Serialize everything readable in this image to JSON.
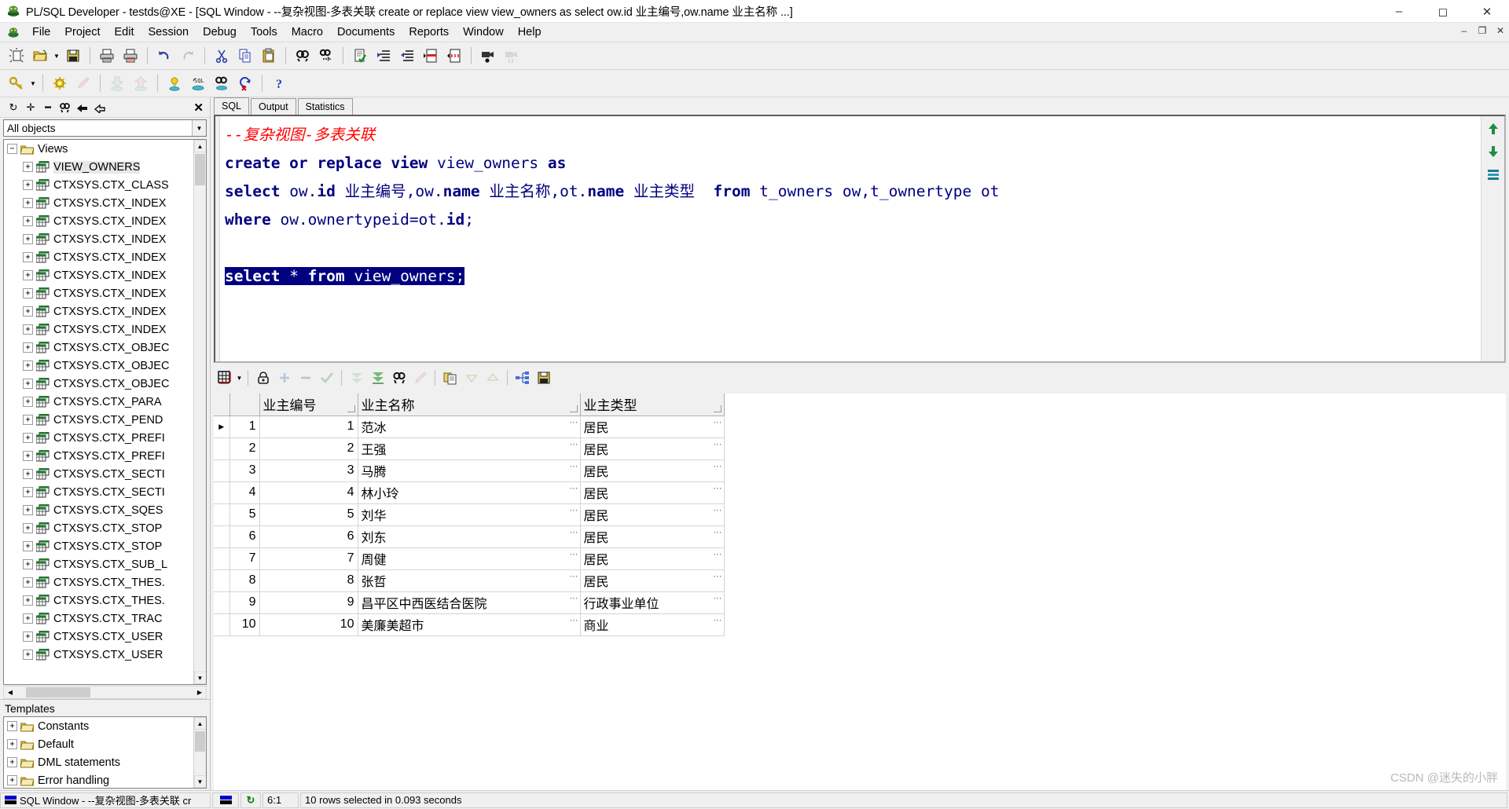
{
  "window": {
    "title": "PL/SQL Developer - testds@XE - [SQL Window - --复杂视图-多表关联 create or replace view view_owners as select ow.id 业主编号,ow.name 业主名称 ...]",
    "app_icon": "plsql-developer-icon",
    "minimize": "–",
    "maximize": "◻",
    "close": "✕",
    "mdi_minimize": "–",
    "mdi_restore": "❐",
    "mdi_close": "✕"
  },
  "menu": {
    "icon": "plsql-developer-icon",
    "items": [
      {
        "label": "File"
      },
      {
        "label": "Project"
      },
      {
        "label": "Edit"
      },
      {
        "label": "Session"
      },
      {
        "label": "Debug"
      },
      {
        "label": "Tools"
      },
      {
        "label": "Macro"
      },
      {
        "label": "Documents"
      },
      {
        "label": "Reports"
      },
      {
        "label": "Window"
      },
      {
        "label": "Help"
      }
    ]
  },
  "toolbar_main": [
    {
      "name": "new-icon",
      "glyph": "▯",
      "disabled": false
    },
    {
      "name": "open-icon",
      "glyph": "📂",
      "disabled": false
    },
    {
      "name": "open-dropdown-arrow-icon",
      "glyph": "▼",
      "dropdown": true
    },
    {
      "name": "save-icon",
      "glyph": "💾",
      "disabled": false
    },
    {
      "name": "separator",
      "sep": true
    },
    {
      "name": "print-icon",
      "glyph": "🖶",
      "disabled": false
    },
    {
      "name": "print-preview-icon",
      "glyph": "🖶",
      "disabled": false
    },
    {
      "name": "separator",
      "sep": true
    },
    {
      "name": "undo-icon",
      "glyph": "↶",
      "disabled": false
    },
    {
      "name": "redo-icon",
      "glyph": "↷",
      "disabled": true
    },
    {
      "name": "separator",
      "sep": true
    },
    {
      "name": "cut-icon",
      "glyph": "✂",
      "disabled": false
    },
    {
      "name": "copy-icon",
      "glyph": "⧉",
      "disabled": false
    },
    {
      "name": "paste-icon",
      "glyph": "📋",
      "disabled": false
    },
    {
      "name": "separator",
      "sep": true
    },
    {
      "name": "find-icon",
      "glyph": "🔍",
      "disabled": false
    },
    {
      "name": "find-next-icon",
      "glyph": "🔍",
      "disabled": false
    },
    {
      "name": "separator",
      "sep": true
    },
    {
      "name": "check-syntax-icon",
      "glyph": "📄",
      "disabled": false
    },
    {
      "name": "indent-icon",
      "glyph": "⇥",
      "disabled": false
    },
    {
      "name": "outdent-icon",
      "glyph": "⇤",
      "disabled": false
    },
    {
      "name": "comment-icon",
      "glyph": "▤",
      "disabled": false
    },
    {
      "name": "uncomment-icon",
      "glyph": "▤",
      "disabled": false
    },
    {
      "name": "separator",
      "sep": true
    },
    {
      "name": "record-macro-icon",
      "glyph": "🎥",
      "disabled": false
    },
    {
      "name": "play-macro-icon",
      "glyph": "🎥",
      "disabled": true
    }
  ],
  "toolbar_secondary": [
    {
      "name": "explain-plan-icon",
      "glyph": "🔑",
      "disabled": false
    },
    {
      "name": "explain-plan-dropdown-arrow-icon",
      "glyph": "▼",
      "dropdown": true
    },
    {
      "name": "separator",
      "sep": true
    },
    {
      "name": "beautifier-icon",
      "glyph": "⚙",
      "disabled": false
    },
    {
      "name": "pencil-icon",
      "glyph": "✎",
      "disabled": true
    },
    {
      "name": "separator",
      "sep": true
    },
    {
      "name": "import-table-icon",
      "glyph": "⬇",
      "disabled": true
    },
    {
      "name": "export-table-icon",
      "glyph": "⬆",
      "disabled": true
    },
    {
      "name": "separator",
      "sep": true
    },
    {
      "name": "session-info-icon",
      "glyph": "💡",
      "disabled": false
    },
    {
      "name": "sql-window-icon",
      "glyph": "SQL",
      "disabled": false
    },
    {
      "name": "find-database-objects-icon",
      "glyph": "🔍",
      "disabled": false
    },
    {
      "name": "rollback-icon",
      "glyph": "↺",
      "disabled": false
    },
    {
      "name": "separator",
      "sep": true
    },
    {
      "name": "help-icon",
      "glyph": "?",
      "disabled": false
    }
  ],
  "browser": {
    "toolbar": [
      {
        "name": "refresh-icon",
        "glyph": "↻"
      },
      {
        "name": "expand-all-icon",
        "glyph": "✛"
      },
      {
        "name": "collapse-all-icon",
        "glyph": "━"
      },
      {
        "name": "find-object-icon",
        "glyph": "🔍"
      },
      {
        "name": "goto-icon",
        "glyph": "↯"
      },
      {
        "name": "filter-icon",
        "glyph": "⌁"
      }
    ],
    "close_glyph": "✕",
    "filter_value": "All objects",
    "filter_arrow": "▼",
    "root": {
      "label": "Views",
      "expander": "−",
      "icon": "folder-open-icon"
    },
    "items": [
      {
        "label": "VIEW_OWNERS",
        "selected": true
      },
      {
        "label": "CTXSYS.CTX_CLASS",
        "selected": false
      },
      {
        "label": "CTXSYS.CTX_INDEX",
        "selected": false
      },
      {
        "label": "CTXSYS.CTX_INDEX",
        "selected": false
      },
      {
        "label": "CTXSYS.CTX_INDEX",
        "selected": false
      },
      {
        "label": "CTXSYS.CTX_INDEX",
        "selected": false
      },
      {
        "label": "CTXSYS.CTX_INDEX",
        "selected": false
      },
      {
        "label": "CTXSYS.CTX_INDEX",
        "selected": false
      },
      {
        "label": "CTXSYS.CTX_INDEX",
        "selected": false
      },
      {
        "label": "CTXSYS.CTX_INDEX",
        "selected": false
      },
      {
        "label": "CTXSYS.CTX_OBJEC",
        "selected": false
      },
      {
        "label": "CTXSYS.CTX_OBJEC",
        "selected": false
      },
      {
        "label": "CTXSYS.CTX_OBJEC",
        "selected": false
      },
      {
        "label": "CTXSYS.CTX_PARA",
        "selected": false
      },
      {
        "label": "CTXSYS.CTX_PEND",
        "selected": false
      },
      {
        "label": "CTXSYS.CTX_PREFI",
        "selected": false
      },
      {
        "label": "CTXSYS.CTX_PREFI",
        "selected": false
      },
      {
        "label": "CTXSYS.CTX_SECTI",
        "selected": false
      },
      {
        "label": "CTXSYS.CTX_SECTI",
        "selected": false
      },
      {
        "label": "CTXSYS.CTX_SQES",
        "selected": false
      },
      {
        "label": "CTXSYS.CTX_STOP",
        "selected": false
      },
      {
        "label": "CTXSYS.CTX_STOP",
        "selected": false
      },
      {
        "label": "CTXSYS.CTX_SUB_L",
        "selected": false
      },
      {
        "label": "CTXSYS.CTX_THES.",
        "selected": false
      },
      {
        "label": "CTXSYS.CTX_THES.",
        "selected": false
      },
      {
        "label": "CTXSYS.CTX_TRAC",
        "selected": false
      },
      {
        "label": "CTXSYS.CTX_USER",
        "selected": false
      },
      {
        "label": "CTXSYS.CTX_USER",
        "selected": false
      }
    ]
  },
  "templates": {
    "header": "Templates",
    "items": [
      {
        "label": "Constants",
        "expander": "+"
      },
      {
        "label": "Default",
        "expander": "+"
      },
      {
        "label": "DML statements",
        "expander": "+"
      },
      {
        "label": "Error handling",
        "expander": "+"
      }
    ]
  },
  "tabs": [
    {
      "label": "SQL",
      "active": true
    },
    {
      "label": "Output",
      "active": false
    },
    {
      "label": "Statistics",
      "active": false
    }
  ],
  "editor": {
    "lines": [
      {
        "kind": "comment",
        "text": "--复杂视图-多表关联"
      },
      {
        "kind": "code",
        "segments": [
          {
            "t": "create or replace view ",
            "c": "kw"
          },
          {
            "t": "view_owners ",
            "c": "id"
          },
          {
            "t": "as",
            "c": "kw"
          }
        ]
      },
      {
        "kind": "code",
        "segments": [
          {
            "t": "select ",
            "c": "kw"
          },
          {
            "t": "ow.",
            "c": "id"
          },
          {
            "t": "id",
            "c": "kw"
          },
          {
            "t": " 业主编号,",
            "c": "id"
          },
          {
            "t": "ow.",
            "c": "id"
          },
          {
            "t": "name",
            "c": "kw"
          },
          {
            "t": " 业主名称,",
            "c": "id"
          },
          {
            "t": "ot.",
            "c": "id"
          },
          {
            "t": "name",
            "c": "kw"
          },
          {
            "t": " 业主类型  ",
            "c": "id"
          },
          {
            "t": "from ",
            "c": "kw"
          },
          {
            "t": "t_owners ow,t_ownertype ot",
            "c": "id"
          }
        ]
      },
      {
        "kind": "code",
        "segments": [
          {
            "t": "where ",
            "c": "kw"
          },
          {
            "t": "ow.ownertypeid=ot.",
            "c": "id"
          },
          {
            "t": "id",
            "c": "kw"
          },
          {
            "t": ";",
            "c": "id"
          }
        ]
      },
      {
        "kind": "blank",
        "text": ""
      },
      {
        "kind": "selected",
        "segments": [
          {
            "t": "select ",
            "c": "kw"
          },
          {
            "t": "* ",
            "c": "id"
          },
          {
            "t": "from ",
            "c": "kw"
          },
          {
            "t": "view_owners;",
            "c": "id"
          }
        ]
      }
    ],
    "side_buttons": [
      {
        "name": "scroll-up-icon",
        "glyph": "⬆",
        "color": "#2e8b2e"
      },
      {
        "name": "scroll-down-icon",
        "glyph": "⬇",
        "color": "#2e8b2e"
      },
      {
        "name": "statement-list-icon",
        "glyph": "▤",
        "color": "#1a7a9a"
      }
    ]
  },
  "grid_toolbar": [
    {
      "name": "grid-layout-icon",
      "glyph": "▦",
      "disabled": false
    },
    {
      "name": "grid-layout-dropdown-arrow-icon",
      "glyph": "▼",
      "dropdown": true
    },
    {
      "name": "separator",
      "sep": true
    },
    {
      "name": "lock-record-icon",
      "glyph": "🔒",
      "disabled": false
    },
    {
      "name": "insert-record-icon",
      "glyph": "✛",
      "disabled": true
    },
    {
      "name": "delete-record-icon",
      "glyph": "━",
      "disabled": true
    },
    {
      "name": "post-changes-icon",
      "glyph": "✔",
      "disabled": true
    },
    {
      "name": "separator",
      "sep": true
    },
    {
      "name": "fetch-next-page-icon",
      "glyph": "⏬",
      "disabled": true
    },
    {
      "name": "fetch-last-page-icon",
      "glyph": "⏬",
      "disabled": false
    },
    {
      "name": "find-in-grid-icon",
      "glyph": "🔍",
      "disabled": false
    },
    {
      "name": "clear-filter-icon",
      "glyph": "✎",
      "disabled": true
    },
    {
      "name": "separator",
      "sep": true
    },
    {
      "name": "copy-to-clipboard-icon",
      "glyph": "⧉",
      "disabled": false
    },
    {
      "name": "sort-desc-icon",
      "glyph": "▽",
      "disabled": true
    },
    {
      "name": "sort-asc-icon",
      "glyph": "△",
      "disabled": true
    },
    {
      "name": "separator",
      "sep": true
    },
    {
      "name": "view-as-tree-icon",
      "glyph": "⛬",
      "disabled": false
    },
    {
      "name": "export-results-icon",
      "glyph": "💾",
      "disabled": false
    }
  ],
  "results": {
    "columns": [
      "业主编号",
      "业主名称",
      "业主类型"
    ],
    "rows": [
      {
        "n": "1",
        "cells": [
          "1",
          "范冰",
          "居民"
        ]
      },
      {
        "n": "2",
        "cells": [
          "2",
          "王强",
          "居民"
        ]
      },
      {
        "n": "3",
        "cells": [
          "3",
          "马腾",
          "居民"
        ]
      },
      {
        "n": "4",
        "cells": [
          "4",
          "林小玲",
          "居民"
        ]
      },
      {
        "n": "5",
        "cells": [
          "5",
          "刘华",
          "居民"
        ]
      },
      {
        "n": "6",
        "cells": [
          "6",
          "刘东",
          "居民"
        ]
      },
      {
        "n": "7",
        "cells": [
          "7",
          "周健",
          "居民"
        ]
      },
      {
        "n": "8",
        "cells": [
          "8",
          "张哲",
          "居民"
        ]
      },
      {
        "n": "9",
        "cells": [
          "9",
          "昌平区中西医结合医院",
          "行政事业单位"
        ]
      },
      {
        "n": "10",
        "cells": [
          "10",
          "美廉美超市",
          "商业"
        ]
      }
    ],
    "current_row_marker": "▶",
    "cell_ellipsis": "⋯"
  },
  "statusbar": {
    "window_label": "SQL Window - --复杂视图-多表关联 cr",
    "connection_icon": "connection-icon",
    "refresh_icon": "↻",
    "cursor_position": "6:1",
    "message": "10 rows selected in 0.093 seconds"
  },
  "watermark": "CSDN @迷失的小胖",
  "colors": {
    "keyword": "#000080",
    "comment": "#ff0000",
    "selection_bg": "#000080",
    "selection_fg": "#ffffff",
    "chrome": "#f0f0f0"
  }
}
